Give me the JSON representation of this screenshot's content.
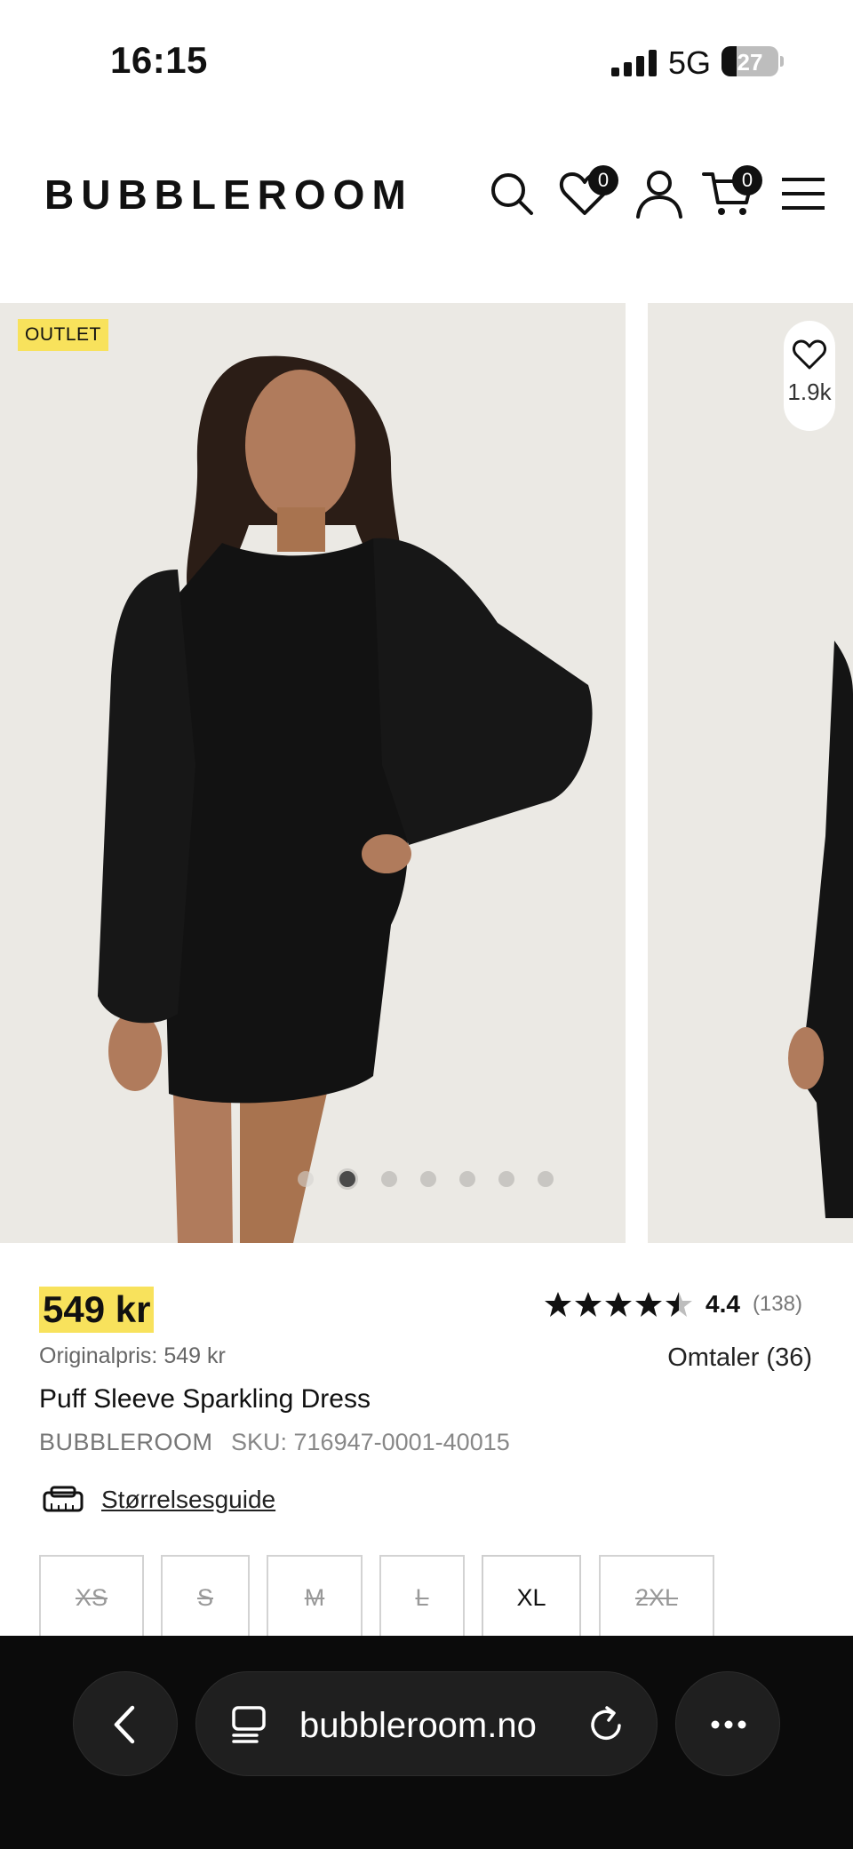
{
  "status": {
    "time": "16:15",
    "network": "5G",
    "battery": "27"
  },
  "header": {
    "logo": "BUBBLEROOM",
    "wishlist_count": "0",
    "cart_count": "0"
  },
  "gallery": {
    "badge": "OUTLET",
    "favorite_count": "1.9k",
    "active_slide": 2,
    "slide_count": 7
  },
  "product": {
    "price": "549 kr",
    "original_price": "Originalpris: 549 kr",
    "name": "Puff Sleeve Sparkling Dress",
    "brand": "BUBBLEROOM",
    "sku": "SKU: 716947-0001-40015",
    "rating": "4.4",
    "rating_value": 4.4,
    "rating_count": "(138)",
    "reviews_link": "Omtaler (36)",
    "size_guide": "Størrelsesguide",
    "sizes": [
      {
        "label": "XS",
        "available": false
      },
      {
        "label": "S",
        "available": false
      },
      {
        "label": "M",
        "available": false
      },
      {
        "label": "L",
        "available": false
      },
      {
        "label": "XL",
        "available": true
      },
      {
        "label": "2XL",
        "available": false
      }
    ]
  },
  "browser": {
    "url": "bubbleroom.no"
  },
  "colors": {
    "highlight": "#f8e25c",
    "text": "#111111",
    "browser_bg": "#0b0b0b"
  }
}
